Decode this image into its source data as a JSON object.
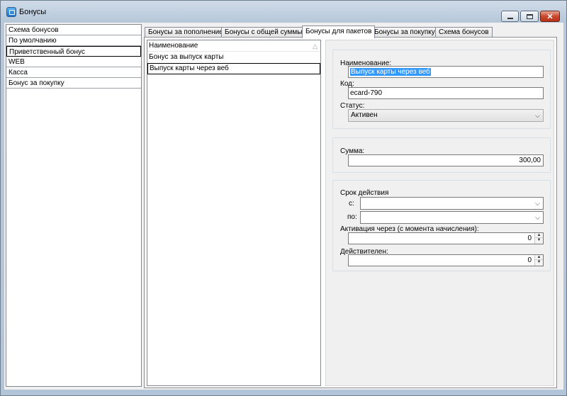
{
  "window": {
    "title": "Бонусы"
  },
  "left_list": {
    "items": [
      {
        "label": "Схема бонусов"
      },
      {
        "label": "По умолчанию"
      },
      {
        "label": "Приветственный бонус"
      },
      {
        "label": "WEB"
      },
      {
        "label": "Касса"
      },
      {
        "label": "Бонус за покупку"
      }
    ],
    "selected_index": 2
  },
  "tabs": [
    {
      "label": "Бонусы за пополнение"
    },
    {
      "label": "Бонусы с общей суммы"
    },
    {
      "label": "Бонусы для пакетов"
    },
    {
      "label": "Бонусы за покупку"
    },
    {
      "label": "Схема бонусов"
    }
  ],
  "active_tab": 2,
  "grid": {
    "header": "Наименование",
    "rows": [
      {
        "label": "Бонус за выпуск карты"
      },
      {
        "label": "Выпуск карты через веб"
      }
    ]
  },
  "form": {
    "name_label": "Наименование:",
    "name_value": "Выпуск карты через веб",
    "code_label": "Код:",
    "code_value": "ecard-790",
    "status_label": "Статус:",
    "status_value": "Активен",
    "sum_label": "Сумма:",
    "sum_value": "300,00",
    "validity_label": "Срок действия",
    "from_label": "с:",
    "from_value": "",
    "to_label": "по:",
    "to_value": "",
    "activation_label": "Активация через (с момента начисления):",
    "activation_value": "0",
    "valid_label": "Действителен:",
    "valid_value": "0"
  }
}
